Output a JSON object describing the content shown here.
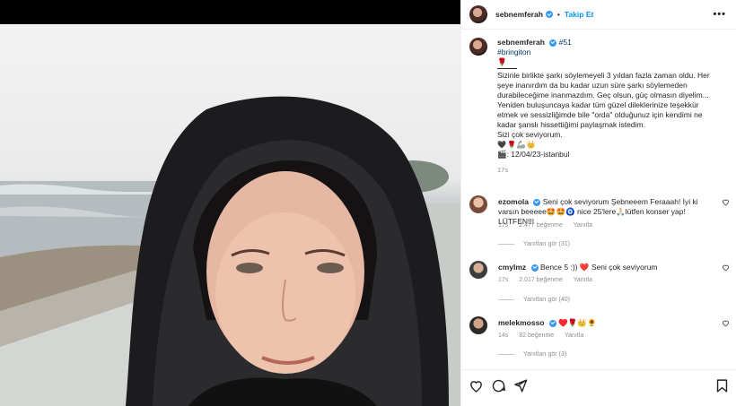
{
  "header": {
    "username": "sebnemferah",
    "follow_label": "Takip Et",
    "more_icon": "more-horizontal-icon"
  },
  "caption": {
    "username": "sebnemferah",
    "tag_number": "#51",
    "hashtag": "#bringiton",
    "rose_emoji": "🌹",
    "lines": [
      "Sizinle birlikte şarkı söylemeyeli 3 yıldan fazla zaman oldu. Her şeye inanırdım da bu kadar uzun süre şarkı söylemeden durabileceğime inanmazdım. Geç olsun, güç olmasın diyelim...",
      "Yeniden buluşuncaya kadar tüm güzel dileklerinize teşekkür etmek ve sessizliğimde bile \"orda\" olduğunuz için kendimi ne kadar şanslı hissettiğimi paylaşmak istedim.",
      "Sizi çok seviyorum."
    ],
    "emoji_row": "🖤🌹🦾👑",
    "date_line": "🎬: 12/04/23-istanbul",
    "time": "17s"
  },
  "comments": [
    {
      "username": "ezomola",
      "text": "Seni çok seviyorum Şebneeem Feraaah! İyi ki varsın beeeee🤩🤩🧿 nice 25'lere🙏🏻lütfen konser yap! LÜTFEN!!!",
      "time": "17s",
      "likes": "2.477 beğenme",
      "reply_label": "Yanıtla",
      "view_replies": "Yanıtları gör (31)"
    },
    {
      "username": "cmylmz",
      "text": "Bence 5 :)) ❤️ Seni çok seviyorum",
      "time": "17s",
      "likes": "2.017 beğenme",
      "reply_label": "Yanıtla",
      "view_replies": "Yanıtları gör (40)"
    },
    {
      "username": "melekmosso",
      "text": "♥️🌹👑🌻",
      "time": "14s",
      "likes": "82 beğenme",
      "reply_label": "Yanıtla",
      "view_replies": "Yanıtları gör (3)"
    }
  ],
  "actions": {
    "like_icon": "heart-icon",
    "comment_icon": "comment-icon",
    "share_icon": "share-icon",
    "save_icon": "bookmark-icon"
  },
  "colors": {
    "link_blue": "#0095f6",
    "verified_blue": "#3897f0",
    "hashtag_blue": "#00376b",
    "muted_text": "#8e8e8e",
    "heart_red": "#ed4956"
  }
}
